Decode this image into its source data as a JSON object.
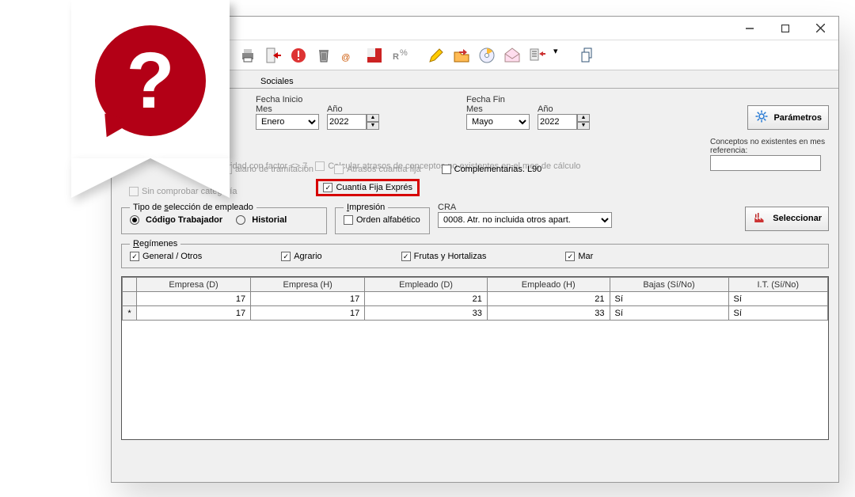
{
  "tab": {
    "label": "Sociales"
  },
  "fecha_inicio": {
    "title": "Fecha Inicio",
    "mes_label": "Mes",
    "mes_value": "Enero",
    "ano_label": "Año",
    "ano_value": "2022"
  },
  "fecha_fin": {
    "title": "Fecha Fin",
    "mes_label": "Mes",
    "mes_value": "Mayo",
    "ano_label": "Año",
    "ano_value": "2022"
  },
  "parametros_label": "Parámetros",
  "seleccionar_label": "Seleccionar",
  "checks": {
    "antiguedad_factor": "idad con factor <> 7",
    "calcular_atrasos": "Calcular atrasos de conceptos no existentes en el mes de cálculo",
    "salario_tramitacion": "alario de tramitación",
    "atrasos_cuantia_fija": "Atrasos cuantía fija",
    "complementarias": "Complementarias. L90",
    "sin_comprobar": "Sin comprobar categoría",
    "cuantia_fija_expres": "Cuantía Fija Exprés"
  },
  "conceptos_label": "Conceptos no existentes en mes referencia:",
  "tipo_seleccion": {
    "legend": "Tipo de selección de empleado",
    "codigo": "Código Trabajador",
    "historial": "Historial"
  },
  "impresion": {
    "legend": "Impresión",
    "orden": "Orden alfabético"
  },
  "cra": {
    "label": "CRA",
    "value": "0008. Atr. no incluida otros apart."
  },
  "regimenes": {
    "legend": "Regímenes",
    "general": "General / Otros",
    "agrario": "Agrario",
    "frutas": "Frutas y Hortalizas",
    "mar": "Mar"
  },
  "grid": {
    "headers": [
      "Empresa (D)",
      "Empresa (H)",
      "Empleado (D)",
      "Empleado (H)",
      "Bajas (Sí/No)",
      "I.T. (Sí/No)"
    ],
    "rows": [
      {
        "marker": "",
        "empresaD": "17",
        "empresaH": "17",
        "empleadoD": "21",
        "empleadoH": "21",
        "bajas": "Sí",
        "it": "Sí"
      },
      {
        "marker": "*",
        "empresaD": "17",
        "empresaH": "17",
        "empleadoD": "33",
        "empleadoH": "33",
        "bajas": "Sí",
        "it": "Sí"
      }
    ]
  },
  "underline": {
    "s": "s",
    "seleccion": "elección de empleado"
  }
}
